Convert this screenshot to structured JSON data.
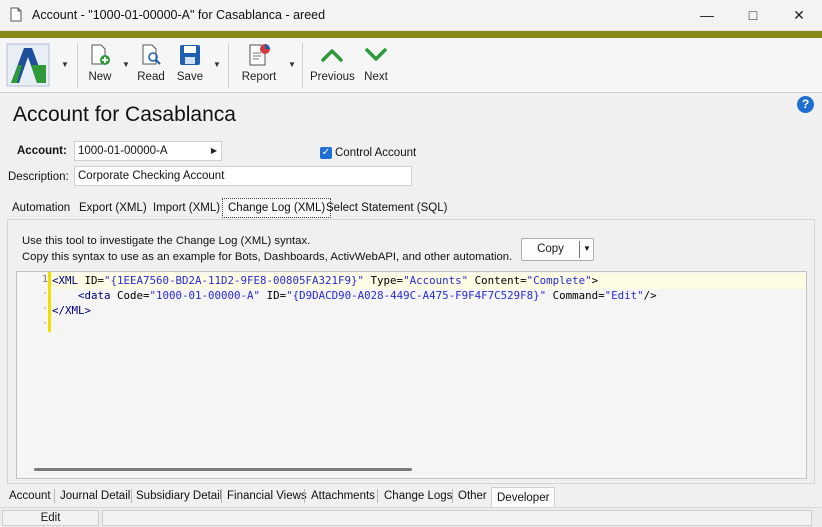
{
  "window": {
    "title": "Account - \"1000-01-00000-A\" for Casablanca - areed"
  },
  "toolbar": {
    "new_label": "New",
    "read_label": "Read",
    "save_label": "Save",
    "report_label": "Report",
    "previous_label": "Previous",
    "next_label": "Next"
  },
  "page": {
    "title": "Account for Casablanca"
  },
  "form": {
    "account_label": "Account:",
    "account_value": "1000-01-00000-A",
    "control_account_label": "Control Account",
    "control_account_checked": true,
    "description_label": "Description:",
    "description_value": "Corporate Checking Account"
  },
  "upper_tabs": [
    {
      "label": "Automation"
    },
    {
      "label": "Export (XML)"
    },
    {
      "label": "Import (XML)"
    },
    {
      "label": "Change Log (XML)"
    },
    {
      "label": "Select Statement (SQL)"
    }
  ],
  "panel": {
    "help_line1": "Use this tool to investigate the Change Log (XML) syntax.",
    "help_line2": "Copy this syntax to use as an example for Bots, Dashboards, ActivWebAPI, and other automation.",
    "copy_label": "Copy"
  },
  "editor": {
    "line_number": "1",
    "line1": {
      "open": "<XML",
      "a1": " ID=",
      "v1": "\"{1EEA7560-BD2A-11D2-9FE8-00805FA321F9}\"",
      "a2": " Type=",
      "v2": "\"Accounts\"",
      "a3": " Content=",
      "v3": "\"Complete\"",
      "close": ">"
    },
    "line2": {
      "open": "<data",
      "a1": " Code=",
      "v1": "\"1000-01-00000-A\"",
      "a2": " ID=",
      "v2": "\"{D9DACD90-A028-449C-A475-F9F4F7C529F8}\"",
      "a3": " Command=",
      "v3": "\"Edit\"",
      "close": "/>"
    },
    "line3": {
      "close_tag": "</XML>"
    }
  },
  "bottom_tabs": [
    {
      "label": "Account"
    },
    {
      "label": "Journal Detail"
    },
    {
      "label": "Subsidiary Detail"
    },
    {
      "label": "Financial Views"
    },
    {
      "label": "Attachments"
    },
    {
      "label": "Change Logs"
    },
    {
      "label": "Other"
    },
    {
      "label": "Developer"
    }
  ],
  "status": {
    "mode": "Edit"
  },
  "colors": {
    "accent_olive": "#8a8a18",
    "nav_green": "#2e9a3a",
    "checkbox_blue": "#1f6fd6",
    "xml_value_blue": "#2a2ad0",
    "xml_tag_navy": "#000080"
  }
}
